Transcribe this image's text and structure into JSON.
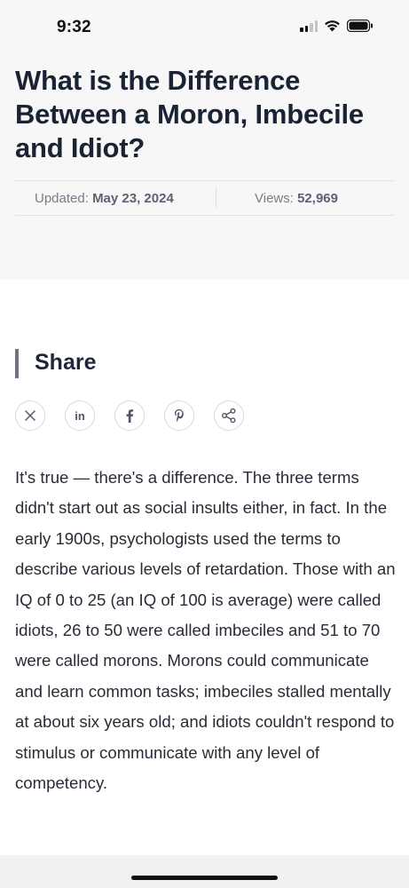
{
  "status_bar": {
    "time": "9:32",
    "icons": [
      "cellular-signal-icon",
      "wifi-icon",
      "battery-icon"
    ]
  },
  "article": {
    "title": "What is the Difference Between a Moron, Imbecile and Idiot?",
    "updated_label": "Updated:",
    "updated_date": "May 23, 2024",
    "views_label": "Views:",
    "views_count": "52,969"
  },
  "share": {
    "title": "Share",
    "buttons": [
      {
        "name": "x-icon",
        "glyph": "𝕏"
      },
      {
        "name": "linkedin-icon",
        "glyph": "in"
      },
      {
        "name": "facebook-icon",
        "glyph": "f"
      },
      {
        "name": "pinterest-icon",
        "glyph": "p"
      },
      {
        "name": "share-nodes-icon",
        "glyph": ""
      }
    ]
  },
  "body": {
    "paragraph": "It's true — there's a difference. The three terms didn't start out as social insults either, in fact. In the early 1900s, psychologists used the terms to describe various levels of retardation. Those with an IQ of 0 to 25 (an IQ of 100 is average) were called idiots, 26 to 50 were called imbeciles and 51 to 70 were called morons. Morons could communicate and learn common tasks; imbeciles stalled mentally at about six years old; and idiots couldn't respond to stimulus or communicate with any level of competency."
  },
  "colors": {
    "header_bg": "#f7f7f8",
    "title": "#1a2333",
    "meta_text": "#777d8a",
    "share_bar": "#6f7585"
  }
}
